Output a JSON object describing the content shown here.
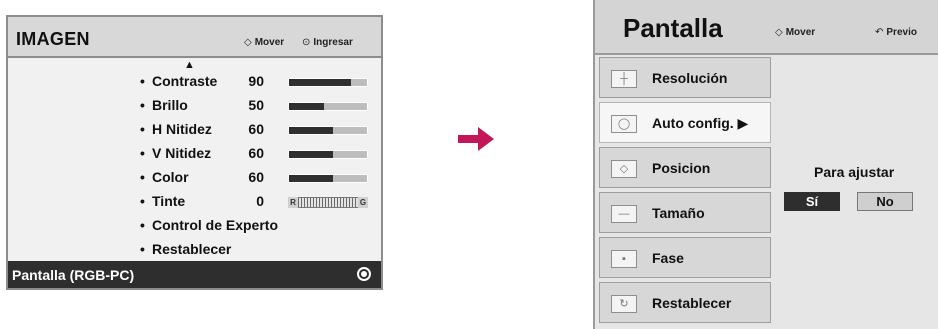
{
  "imagen": {
    "title": "IMAGEN",
    "hint_move_icon": "◇",
    "hint_move": "Mover",
    "hint_enter_icon": "⊙",
    "hint_enter": "Ingresar",
    "items": [
      {
        "label": "Contraste",
        "value": "90",
        "level": 0.8
      },
      {
        "label": "Brillo",
        "value": "50",
        "level": 0.45
      },
      {
        "label": "H Nitidez",
        "value": "60",
        "level": 0.57
      },
      {
        "label": "V Nitidez",
        "value": "60",
        "level": 0.57
      },
      {
        "label": "Color",
        "value": "60",
        "level": 0.57
      },
      {
        "label": "Tinte",
        "value": "0",
        "tint_left": "R",
        "tint_right": "G"
      },
      {
        "label": "Control de Experto"
      },
      {
        "label": "Restablecer"
      }
    ],
    "selected_footer": "Pantalla (RGB-PC)",
    "bullet": "•",
    "colors": {
      "bar_fill": "#2f2f2f",
      "bar_track": "#bdbdbd",
      "footer_bg": "#2e2e2e"
    }
  },
  "arrow": {
    "color": "#c2185b"
  },
  "pantalla": {
    "title": "Pantalla",
    "hint_move_icon": "◇",
    "hint_move": "Mover",
    "hint_prev_icon": "↶",
    "hint_prev": "Previo",
    "items": [
      {
        "label": "Resolución",
        "icon": "resolution-icon",
        "glyph": "┼"
      },
      {
        "label": "Auto config. ▶",
        "icon": "auto-config-icon",
        "glyph": "◯"
      },
      {
        "label": "Posicion",
        "icon": "position-icon",
        "glyph": "◇"
      },
      {
        "label": "Tamaño",
        "icon": "size-icon",
        "glyph": "—"
      },
      {
        "label": "Fase",
        "icon": "phase-icon",
        "glyph": "▪"
      },
      {
        "label": "Restablecer",
        "icon": "reset-icon",
        "glyph": "↻"
      }
    ],
    "active_index": 1,
    "prompt": "Para ajustar",
    "yes_label": "Sí",
    "no_label": "No"
  }
}
